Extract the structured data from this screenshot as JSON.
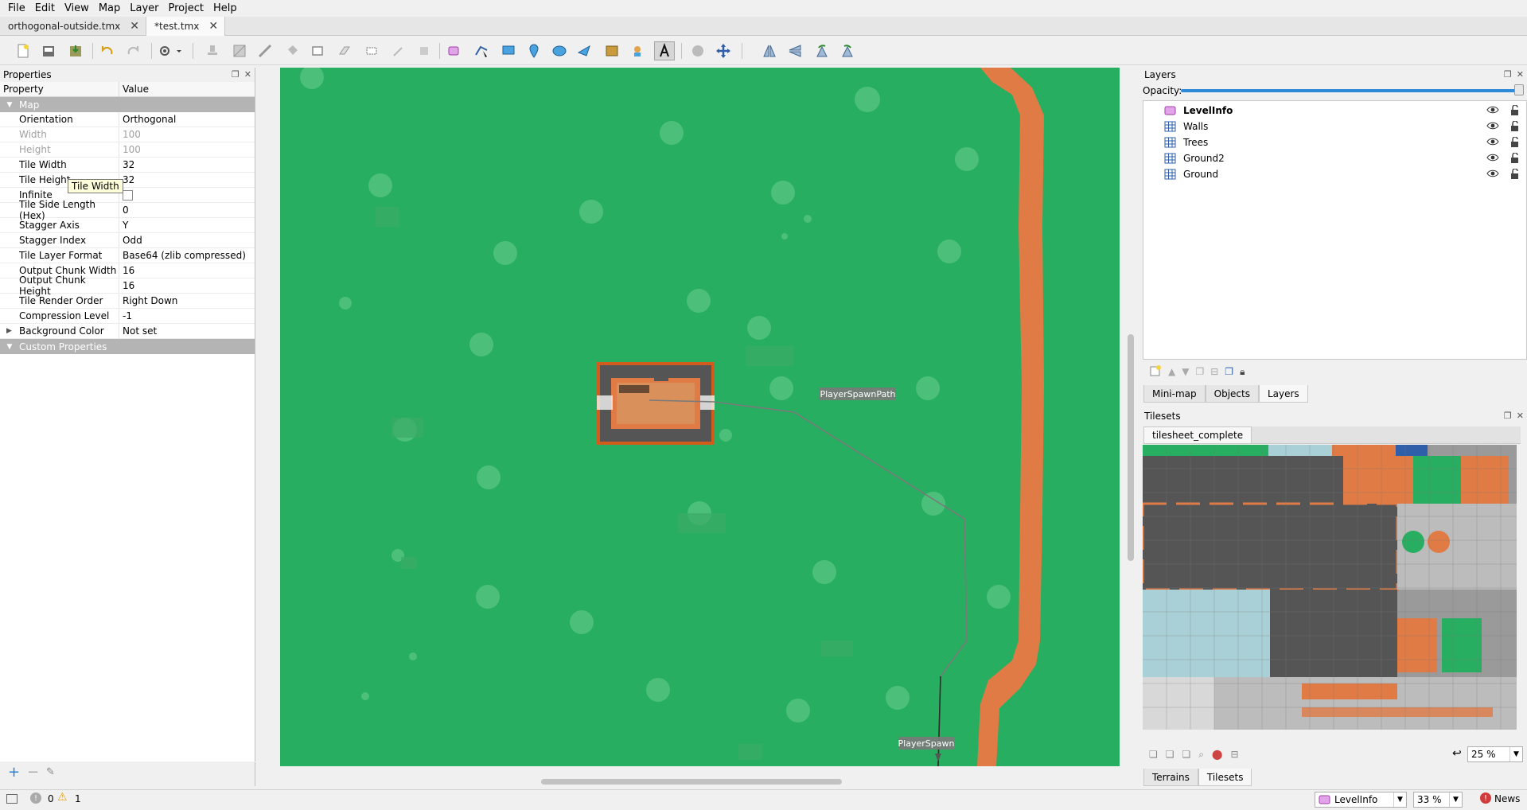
{
  "menu": [
    "File",
    "Edit",
    "View",
    "Map",
    "Layer",
    "Project",
    "Help"
  ],
  "tabs": [
    {
      "label": "orthogonal-outside.tmx",
      "close": "✕"
    },
    {
      "label": "*test.tmx",
      "close": "✕"
    }
  ],
  "properties": {
    "title": "Properties",
    "col_property": "Property",
    "col_value": "Value",
    "group_map": "Map",
    "rows": [
      {
        "k": "Orientation",
        "v": "Orthogonal"
      },
      {
        "k": "Width",
        "v": "100"
      },
      {
        "k": "Height",
        "v": "100"
      },
      {
        "k": "Tile Width",
        "v": "32"
      },
      {
        "k": "Tile Height",
        "v": "32"
      },
      {
        "k": "Infinite",
        "v": ""
      },
      {
        "k": "Tile Side Length (Hex)",
        "v": "0"
      },
      {
        "k": "Stagger Axis",
        "v": "Y"
      },
      {
        "k": "Stagger Index",
        "v": "Odd"
      },
      {
        "k": "Tile Layer Format",
        "v": "Base64 (zlib compressed)"
      },
      {
        "k": "Output Chunk Width",
        "v": "16"
      },
      {
        "k": "Output Chunk Height",
        "v": "16"
      },
      {
        "k": "Tile Render Order",
        "v": "Right Down"
      },
      {
        "k": "Compression Level",
        "v": "-1"
      },
      {
        "k": "Background Color",
        "v": "Not set"
      }
    ],
    "group_custom": "Custom Properties",
    "tooltip": "Tile Width"
  },
  "map": {
    "object_labels": {
      "path": "PlayerSpawnPath",
      "spawn": "PlayerSpawn"
    },
    "colors": {
      "grass": "#27ae60",
      "path": "#e07b45",
      "tree": "#4cc07a",
      "wall": "#555555"
    }
  },
  "layers": {
    "title": "Layers",
    "opacity_label": "Opacity:",
    "opacity": 1.0,
    "items": [
      "LevelInfo",
      "Walls",
      "Trees",
      "Ground2",
      "Ground"
    ],
    "tabs": [
      "Mini-map",
      "Objects",
      "Layers"
    ]
  },
  "tilesets": {
    "title": "Tilesets",
    "tab": "tilesheet_complete",
    "zoom": "25 %",
    "tabs": [
      "Terrains",
      "Tilesets"
    ]
  },
  "status": {
    "errors": "0",
    "warnings": "1",
    "layer": "LevelInfo",
    "zoom": "33 %",
    "news": "News"
  }
}
